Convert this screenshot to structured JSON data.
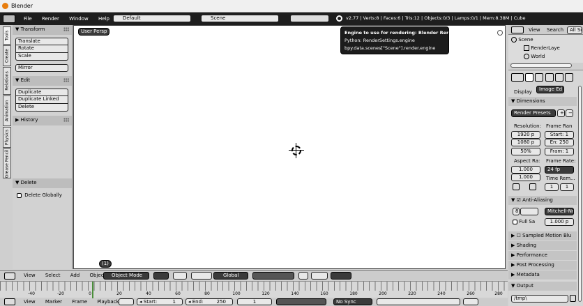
{
  "window": {
    "title": "Blender"
  },
  "topbar": {
    "menus": [
      "File",
      "Render",
      "Window",
      "Help"
    ],
    "layout": "Default",
    "scene": "Scene",
    "stats": "v2.77 | Verts:8 | Faces:6 | Tris:12 | Objects:0/3 | Lamps:0/1 | Mem:8.38M | Cube"
  },
  "tool_tabs": [
    "Tools",
    "Create",
    "Relations",
    "Animation",
    "Physics",
    "Grease Pencil"
  ],
  "toolshelf": {
    "transform": {
      "title": "Transform",
      "buttons": [
        "Translate",
        "Rotate",
        "Scale",
        "Mirror"
      ]
    },
    "edit": {
      "title": "Edit",
      "buttons": [
        "Duplicate",
        "Duplicate Linked",
        "Delete"
      ]
    },
    "history": {
      "title": "History"
    },
    "delete": {
      "title": "Delete",
      "item": "Delete Globally"
    }
  },
  "viewport": {
    "label": "User Persp",
    "object_label": "(1)"
  },
  "tooltip": {
    "line1": "Engine to use for rendering:  Blender Render",
    "line2": "Python:  RenderSettings.engine",
    "line3": "bpy.data.scenes[\"Scene\"].render.engine"
  },
  "viewport_header": {
    "menus": [
      "View",
      "Select",
      "Add",
      "Object"
    ],
    "mode": "Object Mode",
    "pivot": "Global"
  },
  "timeline": {
    "ticks": [
      "-40",
      "-20",
      "0",
      "20",
      "40",
      "60",
      "80",
      "100",
      "120",
      "140",
      "160",
      "180",
      "200",
      "220",
      "240",
      "260",
      "280"
    ],
    "menus": [
      "View",
      "Marker",
      "Frame",
      "Playback"
    ],
    "start_label": "Start:",
    "start_value": "1",
    "end_label": "End:",
    "end_value": "250",
    "current": "1",
    "sync": "No Sync"
  },
  "outliner": {
    "tabs": [
      "View",
      "Search",
      "All Sc"
    ],
    "items": [
      "Scene",
      "RenderLaye",
      "World"
    ]
  },
  "properties": {
    "display_label": "Display",
    "display_value": "Image Ed",
    "dimensions": {
      "title": "Dimensions",
      "preset": "Render Presets",
      "resolution_label": "Resolution:",
      "res_x": "1920 p",
      "res_y": "1080 p",
      "res_pct": "50%",
      "aspect_label": "Aspect Ra:",
      "aspect_x": "1.000",
      "aspect_y": "1.000",
      "frame_range_label": "Frame Ran",
      "start": "Start: 1",
      "end": "En: 250",
      "step": "Fram: 1",
      "frame_rate_label": "Frame Rate:",
      "frame_rate": "24 fp",
      "time_remap_label": "Time Rem...",
      "time_old": "1",
      "time_new": "1"
    },
    "anti_aliasing": {
      "title": "Anti-Aliasing",
      "filter": "Mitchell-Ne",
      "full_sample": "Full Sa",
      "size": "1.000 p"
    },
    "sections": [
      "Sampled Motion Blu",
      "Shading",
      "Performance",
      "Post Processing",
      "Metadata",
      "Output"
    ],
    "output_path": "/tmp\\"
  }
}
